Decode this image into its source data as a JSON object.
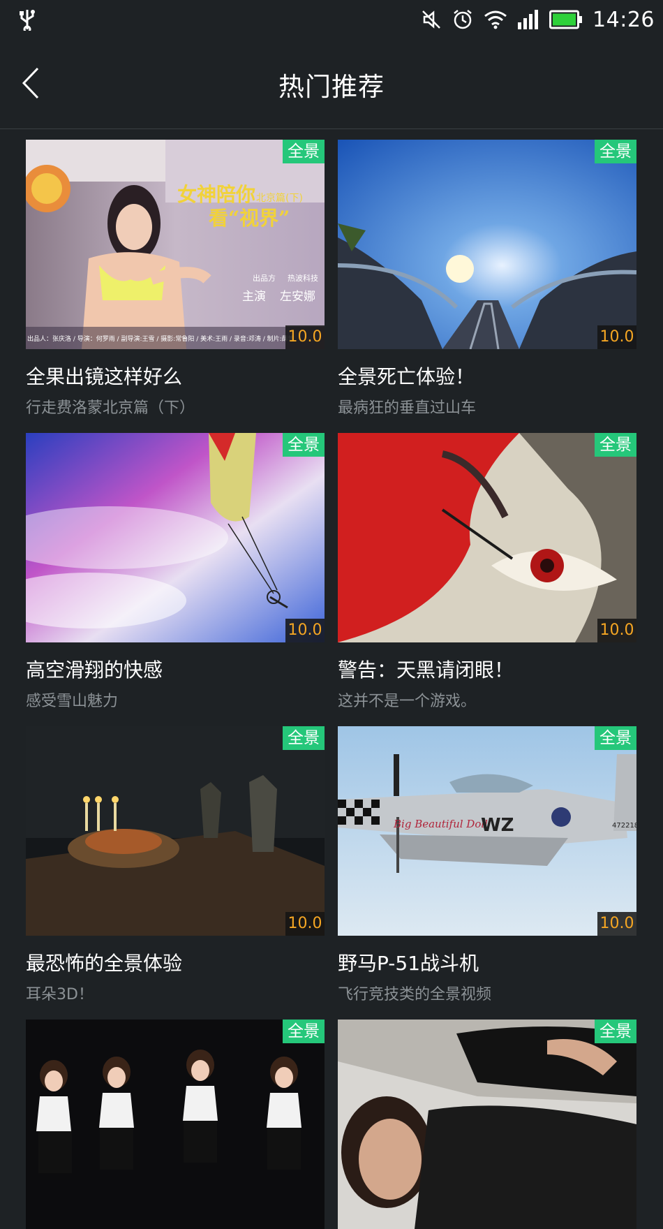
{
  "status_bar": {
    "time": "14:26",
    "icons": [
      "usb-icon",
      "mute-icon",
      "alarm-icon",
      "wifi-icon",
      "signal-icon",
      "battery-icon"
    ],
    "battery_color": "#2ed13a"
  },
  "header": {
    "title": "热门推荐",
    "back_icon": "chevron-left-icon"
  },
  "colors": {
    "background": "#1e2225",
    "badge": "#25c77a",
    "score": "#f5a623",
    "subtitle": "#8c9296"
  },
  "cards": [
    {
      "title": "全果出镜这样好么",
      "subtitle": "行走费洛蒙北京篇（下）",
      "badge": "全景",
      "score": "10.0",
      "poster_text": {
        "main": "女神陪你",
        "main2": "看“视界”",
        "city": "北京篇(下)",
        "producer_label": "出品方",
        "producer": "热波科技",
        "lead_label": "主演",
        "lead": "左安娜",
        "credits": "出品人：张庆洛 / 导演：何罗雨 / 副导演:王雪 / 摄影:常鲁阳 / 美术:王雨 / 录音:邓涛 / 制片:薛博"
      }
    },
    {
      "title": "全景死亡体验！",
      "subtitle": "最病狂的垂直过山车",
      "badge": "全景",
      "score": "10.0"
    },
    {
      "title": "高空滑翔的快感",
      "subtitle": "感受雪山魅力",
      "badge": "全景",
      "score": "10.0"
    },
    {
      "title": "警告：天黑请闭眼！",
      "subtitle": "这并不是一个游戏。",
      "badge": "全景",
      "score": "10.0"
    },
    {
      "title": "最恐怖的全景体验",
      "subtitle": "耳朵3D！",
      "badge": "全景",
      "score": "10.0"
    },
    {
      "title": "野马P-51战斗机",
      "subtitle": "飞行竞技类的全景视频",
      "badge": "全景",
      "score": "10.0",
      "poster_text": {
        "nose_art": "Big Beautiful Doll",
        "code": "WZ",
        "tail": "472218"
      }
    },
    {
      "title": "",
      "subtitle": "",
      "badge": "全景",
      "score": ""
    },
    {
      "title": "",
      "subtitle": "",
      "badge": "全景",
      "score": ""
    }
  ]
}
